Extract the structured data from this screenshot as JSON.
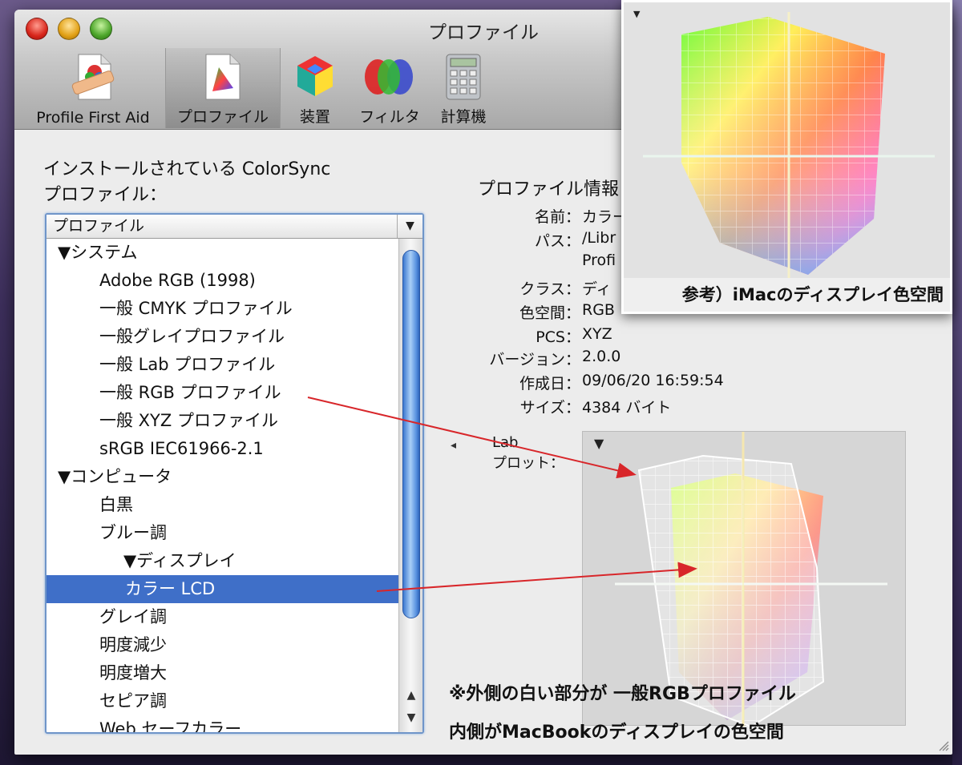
{
  "window": {
    "title": "プロファイル"
  },
  "toolbar": {
    "items": [
      {
        "label": "Profile First Aid",
        "icon": "first-aid-icon"
      },
      {
        "label": "プロファイル",
        "icon": "profile-document-icon",
        "selected": true
      },
      {
        "label": "装置",
        "icon": "device-cube-icon"
      },
      {
        "label": "フィルタ",
        "icon": "filter-icon"
      },
      {
        "label": "計算機",
        "icon": "calculator-icon"
      }
    ]
  },
  "left_panel": {
    "heading_line1": "インストールされている ColorSync",
    "heading_line2": "プロファイル：",
    "list_header": "プロファイル",
    "rows": [
      {
        "label": "▼システム",
        "indent": 0
      },
      {
        "label": "Adobe RGB (1998)",
        "indent": 1
      },
      {
        "label": "一般 CMYK プロファイル",
        "indent": 1
      },
      {
        "label": "一般グレイプロファイル",
        "indent": 1
      },
      {
        "label": "一般 Lab プロファイル",
        "indent": 1
      },
      {
        "label": "一般 RGB プロファイル",
        "indent": 1
      },
      {
        "label": "一般 XYZ プロファイル",
        "indent": 1
      },
      {
        "label": "sRGB IEC61966-2.1",
        "indent": 1
      },
      {
        "label": "▼コンピュータ",
        "indent": 0
      },
      {
        "label": "白黒",
        "indent": 1
      },
      {
        "label": "ブルー調",
        "indent": 1
      },
      {
        "label": "▼ディスプレイ",
        "indent": 2
      },
      {
        "label": "カラー LCD",
        "indent": 3,
        "selected": true
      },
      {
        "label": "グレイ調",
        "indent": 1
      },
      {
        "label": "明度減少",
        "indent": 1
      },
      {
        "label": "明度増大",
        "indent": 1
      },
      {
        "label": "セピア調",
        "indent": 1
      },
      {
        "label": "Web セーフカラー",
        "indent": 1
      }
    ]
  },
  "info_panel": {
    "title": "プロファイル情報",
    "fields": [
      {
        "key": "名前：",
        "value": "カラー"
      },
      {
        "key": "パス：",
        "value": "/Libr"
      },
      {
        "key": "",
        "value": "Profi"
      },
      {
        "key": "クラス：",
        "value": "ディ"
      },
      {
        "key": "色空間：",
        "value": "RGB"
      },
      {
        "key": "PCS：",
        "value": "XYZ"
      },
      {
        "key": "バージョン：",
        "value": "2.0.0"
      },
      {
        "key": "作成日：",
        "value": "09/06/20 16:59:54"
      },
      {
        "key": "サイズ：",
        "value": "4384 バイト"
      }
    ],
    "lab_label_line1": "Lab",
    "lab_label_line2": "プロット："
  },
  "annotations": {
    "line1": "※外側の白い部分が 一般RGBプロファイル",
    "line2": "内側がMacBookのディスプレイの色空間",
    "inset_caption": "参考）iMacのディスプレイ色空間"
  },
  "colors": {
    "selection": "#3f6fc8",
    "arrow": "#d8262a",
    "focus_ring": "#6f95c9"
  }
}
